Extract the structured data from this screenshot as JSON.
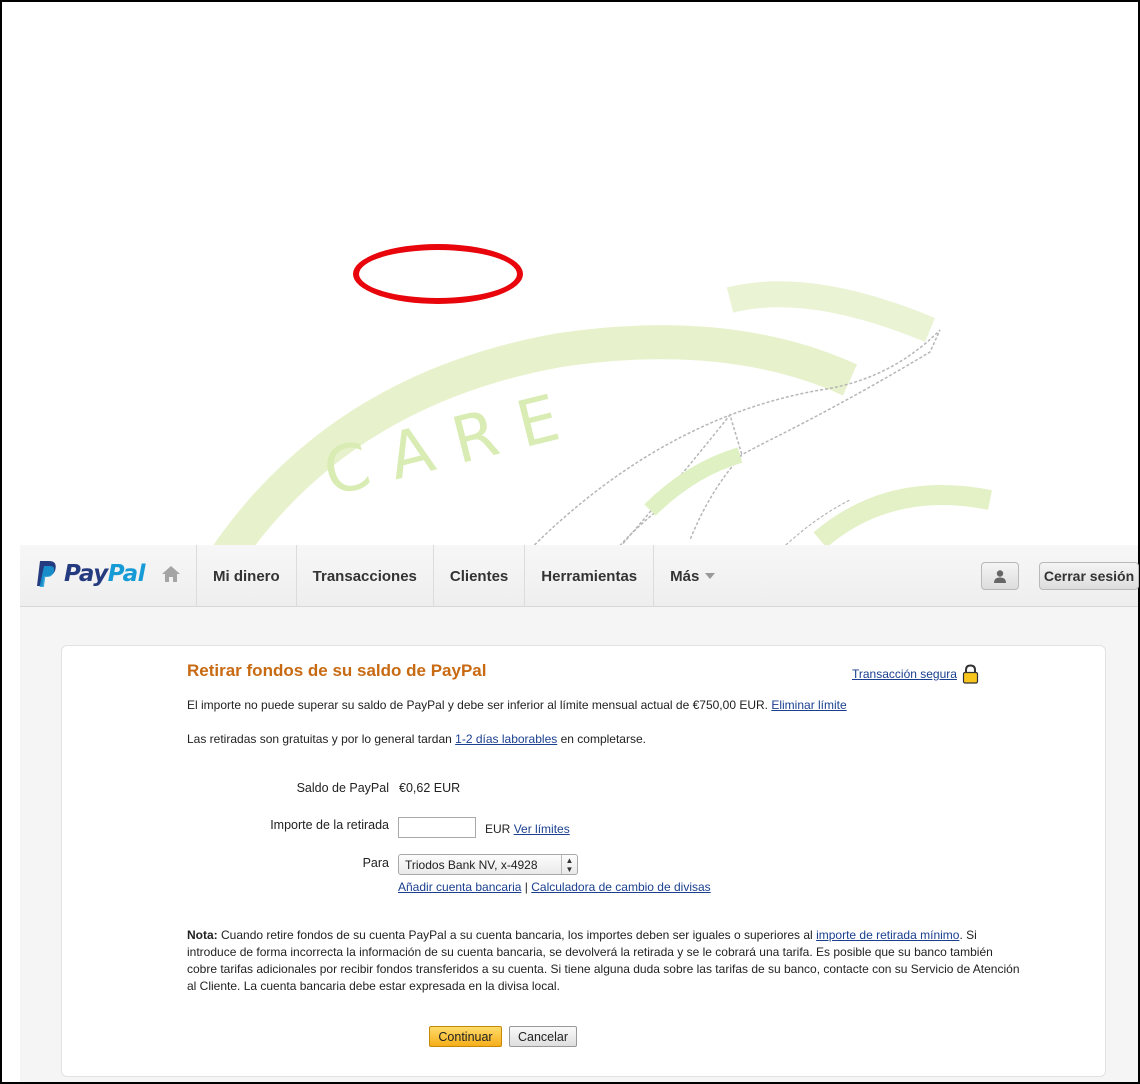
{
  "nav": {
    "logo_pay": "Pay",
    "logo_pal": "Pal",
    "items": [
      "Mi dinero",
      "Transacciones",
      "Clientes",
      "Herramientas",
      "Más"
    ],
    "logout": "Cerrar sesión"
  },
  "form": {
    "title": "Retirar fondos de su saldo de PayPal",
    "secure_link": "Transacción segura",
    "limit_text": "El importe no puede superar su saldo de PayPal y debe ser inferior al límite mensual actual de €750,00 EUR.",
    "limit_link": "Eliminar límite",
    "free_text_pre": "Las retiradas son gratuitas y por lo general tardan",
    "free_link": "1-2 días laborables",
    "free_text_post": "en completarse.",
    "balance_label": "Saldo de PayPal",
    "balance_value": "€0,62 EUR",
    "amount_label": "Importe de la retirada",
    "amount_value": "",
    "currency": "EUR",
    "limits_link": "Ver límites",
    "to_label": "Para",
    "bank_selected": "Triodos Bank NV, x-4928",
    "add_bank_link": "Añadir cuenta bancaria",
    "separator": "|",
    "calculator_link": "Calculadora de cambio de divisas",
    "note_bold": "Nota:",
    "note_text1": "Cuando retire fondos de su cuenta PayPal a su cuenta bancaria, los importes deben ser iguales o superiores al",
    "note_link": "importe de retirada mínimo",
    "note_text2": ". Si introduce de forma incorrecta la información de su cuenta bancaria, se devolverá la retirada y se le cobrará una tarifa. Es posible que su banco también cobre tarifas adicionales por recibir fondos transferidos a su cuenta. Si tiene alguna duda sobre las tarifas de su banco, contacte con su Servicio de Atención al Cliente. La cuenta bancaria debe estar expresada en la divisa local.",
    "continue_button": "Continuar",
    "cancel_button": "Cancelar"
  },
  "watermark": {
    "text": "CARE"
  },
  "colors": {
    "title_orange": "#c86a12",
    "link_blue": "#1a3f8f",
    "highlight_red": "#e8050b",
    "watermark_green": "#d9ecb4"
  }
}
